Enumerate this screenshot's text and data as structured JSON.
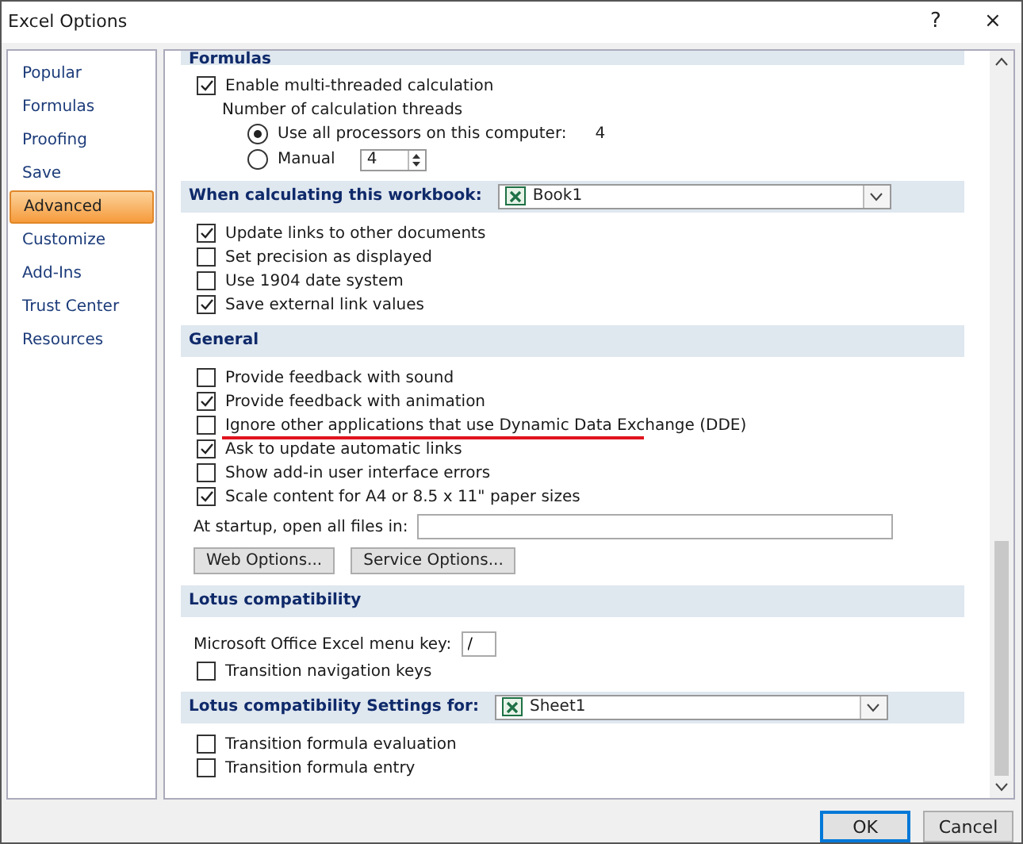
{
  "window": {
    "title": "Excel Options",
    "help": "?",
    "close": "×"
  },
  "nav": [
    {
      "label": "Popular",
      "selected": false
    },
    {
      "label": "Formulas",
      "selected": false
    },
    {
      "label": "Proofing",
      "selected": false
    },
    {
      "label": "Save",
      "selected": false
    },
    {
      "label": "Advanced",
      "selected": true
    },
    {
      "label": "Customize",
      "selected": false
    },
    {
      "label": "Add-Ins",
      "selected": false
    },
    {
      "label": "Trust Center",
      "selected": false
    },
    {
      "label": "Resources",
      "selected": false
    }
  ],
  "sections": [
    {
      "title": "Formulas",
      "cut": true,
      "items": [
        {
          "kind": "checkbox",
          "label": "Enable multi-threaded calculation",
          "checked": true
        },
        {
          "kind": "label",
          "label": "Number of calculation threads"
        },
        {
          "kind": "radio",
          "label": "Use all processors on this computer:",
          "selected": true,
          "value": "4"
        },
        {
          "kind": "radio",
          "label": "Manual",
          "selected": false,
          "spin": "4"
        }
      ]
    },
    {
      "title": "When calculating this workbook:",
      "dropdown": "Book1",
      "items": [
        {
          "kind": "checkbox",
          "label": "Update links to other documents",
          "checked": true
        },
        {
          "kind": "checkbox",
          "label": "Set precision as displayed",
          "checked": false
        },
        {
          "kind": "checkbox",
          "label": "Use 1904 date system",
          "checked": false
        },
        {
          "kind": "checkbox",
          "label": "Save external link values",
          "checked": true
        }
      ]
    },
    {
      "title": "General",
      "items": [
        {
          "kind": "checkbox",
          "label": "Provide feedback with sound",
          "checked": false,
          "underlined": false
        },
        {
          "kind": "checkbox",
          "label": "Provide feedback with animation",
          "checked": true,
          "underlined": false
        },
        {
          "kind": "checkbox",
          "label": "Ignore other applications that use Dynamic Data Exchange (DDE)",
          "checked": false,
          "underlined": true
        },
        {
          "kind": "checkbox",
          "label": "Ask to update automatic links",
          "checked": true,
          "underlined": false
        },
        {
          "kind": "checkbox",
          "label": "Show add-in user interface errors",
          "checked": false,
          "underlined": false
        },
        {
          "kind": "checkbox",
          "label": "Scale content for A4 or 8.5 x 11\" paper sizes",
          "checked": true,
          "underlined": false
        },
        {
          "kind": "field",
          "label": "At startup, open all files in:",
          "wide": true
        },
        {
          "kind": "buttons",
          "buttons": [
            "Web Options...",
            "Service Options..."
          ]
        }
      ]
    },
    {
      "title": "Lotus compatibility",
      "items": [
        {
          "kind": "field",
          "label": "Microsoft Office Excel menu key:",
          "value": "/",
          "wide": false
        },
        {
          "kind": "checkbox",
          "label": "Transition navigation keys",
          "checked": false
        }
      ]
    },
    {
      "title": "Lotus compatibility Settings for:",
      "dropdown": "Sheet1",
      "items": [
        {
          "kind": "checkbox",
          "label": "Transition formula evaluation",
          "checked": false
        },
        {
          "kind": "checkbox",
          "label": "Transition formula entry",
          "checked": false
        }
      ]
    }
  ],
  "footer": {
    "buttons": [
      {
        "label": "OK",
        "default": true
      },
      {
        "label": "Cancel",
        "default": false
      }
    ]
  }
}
